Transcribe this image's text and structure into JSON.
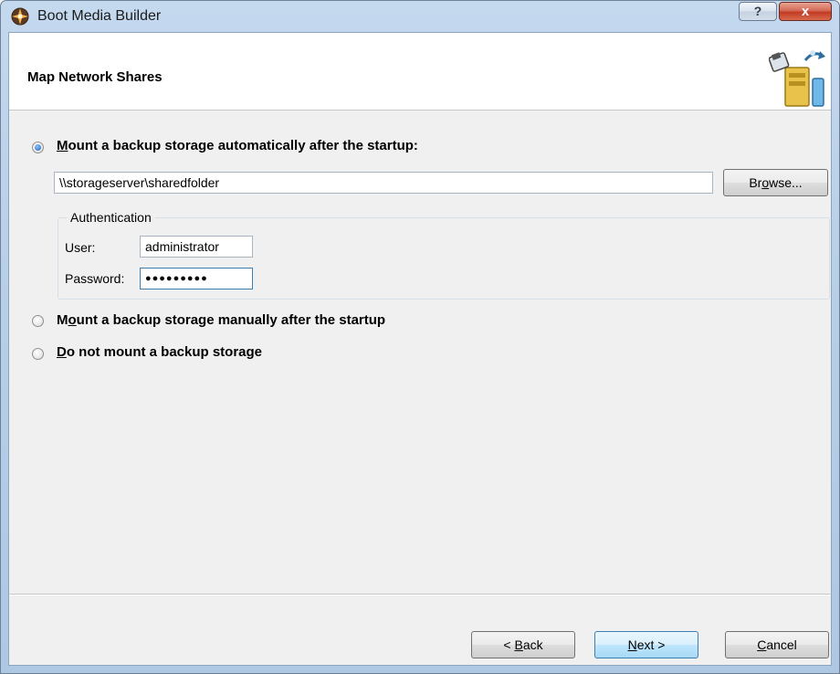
{
  "window": {
    "title": "Boot Media Builder",
    "help_label": "?",
    "close_label": "x"
  },
  "header": {
    "title": "Map Network Shares"
  },
  "options": {
    "auto_mount": {
      "label_pre": "",
      "label_accel": "M",
      "label_post": "ount a backup storage automatically after the startup:",
      "checked": true
    },
    "manual_mount": {
      "label_pre": "M",
      "label_accel": "o",
      "label_post": "unt a backup storage manually after the startup",
      "checked": false
    },
    "no_mount": {
      "label_pre": "",
      "label_accel": "D",
      "label_post": "o not mount a backup storage",
      "checked": false
    }
  },
  "share": {
    "path_value": "\\\\storageserver\\sharedfolder",
    "browse_pre": "Br",
    "browse_accel": "o",
    "browse_post": "wse..."
  },
  "authentication": {
    "legend": "Authentication",
    "user_label": "User:",
    "user_value": "administrator",
    "password_label": "Password:",
    "password_value": "●●●●●●●●●"
  },
  "footer": {
    "back_pre": "< ",
    "back_accel": "B",
    "back_post": "ack",
    "next_accel": "N",
    "next_post": "ext >",
    "cancel_accel": "C",
    "cancel_post": "ancel"
  }
}
